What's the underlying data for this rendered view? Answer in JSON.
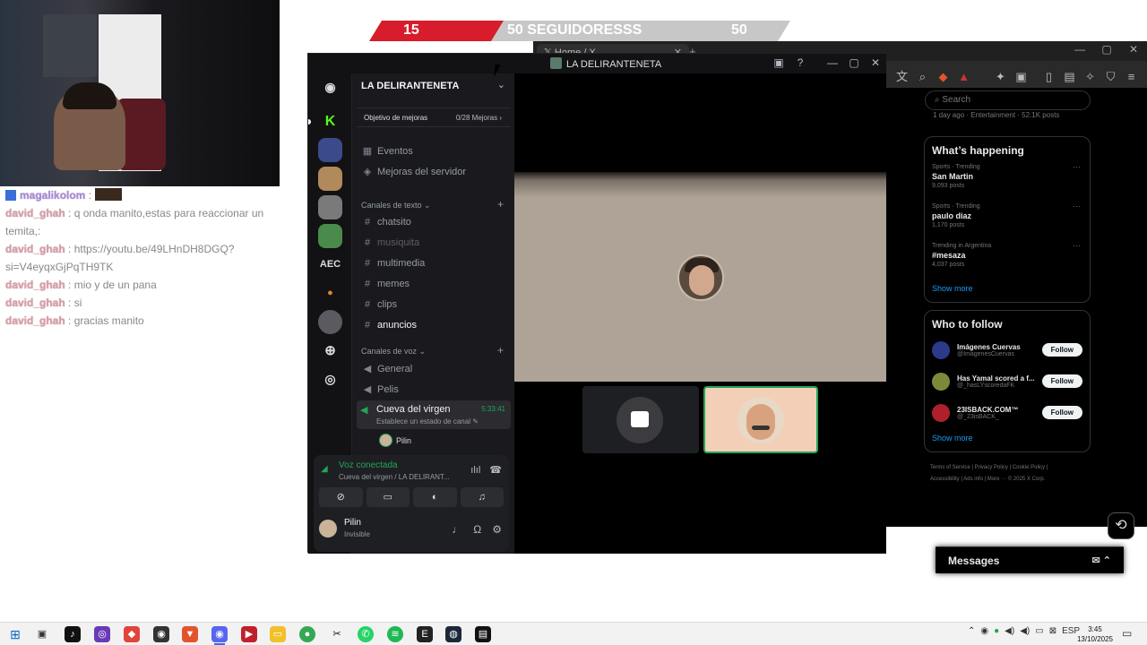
{
  "follower_goal": {
    "current": "15",
    "label": "50 SEGUIDORESSS",
    "goal": "50",
    "progress_fraction": 0.3
  },
  "chat": {
    "messages": [
      {
        "user": "magalikolom",
        "text": ":",
        "badge": "twitch-badge"
      },
      {
        "user": "david_ghah",
        "text": ": q onda manito,estas para reaccionar un temita,:"
      },
      {
        "user": "david_ghah",
        "text": ": https://youtu.be/49LHnDH8DGQ?si=V4eyqxGjPqTH9TK"
      },
      {
        "user": "david_ghah",
        "text": ": mio y de un pana"
      },
      {
        "user": "david_ghah",
        "text": ": si"
      },
      {
        "user": "david_ghah",
        "text": ": gracias manito"
      }
    ]
  },
  "browser": {
    "tab_title": "Home / X",
    "search_placeholder": "Search",
    "top_meta": "1 day ago · Entertainment · 52.1K posts",
    "happening": {
      "title": "What’s happening",
      "trends": [
        {
          "meta": "Sports · Trending",
          "name": "San Martin",
          "posts": "9,093 posts"
        },
        {
          "meta": "Sports · Trending",
          "name": "paulo diaz",
          "posts": "1,170 posts"
        },
        {
          "meta": "Trending in Argentina",
          "name": "#mesaza",
          "posts": "4,037 posts"
        }
      ],
      "show_more": "Show more"
    },
    "who_to_follow": {
      "title": "Who to follow",
      "accounts": [
        {
          "name": "Imágenes Cuervas",
          "handle": "@ImagenesCuervas",
          "button": "Follow"
        },
        {
          "name": "Has Yamal scored a f...",
          "handle": "@_hasLYscoredaFK",
          "button": "Follow"
        },
        {
          "name": "23ISBACK.COM™",
          "handle": "@_23isBACK_",
          "button": "Follow"
        }
      ],
      "show_more": "Show more"
    },
    "legal_line1": "Terms of Service   |   Privacy Policy   |   Cookie Policy   |",
    "legal_line2": "Accessibility   |   Ads info   |   More ···   © 2025 X Corp.",
    "messages": "Messages"
  },
  "discord": {
    "window_title": "LA DELIRANTENETA",
    "server_name": "LA DELIRANTENETA",
    "boost_label": "Objetivo de mejoras",
    "boost_value": "0/28 Mejoras ›",
    "events": "Eventos",
    "boosts": "Mejoras del servidor",
    "text_category": "Canales de texto ⌄",
    "text_channels": [
      "chatsito",
      "musiquita",
      "multimedia",
      "memes",
      "clips",
      "anuncios"
    ],
    "voice_category": "Canales de voz ⌄",
    "voice_channels": [
      "General",
      "Pelis"
    ],
    "active_voice": {
      "name": "Cueva del virgen",
      "time": "5:33:41",
      "status": "Establece un estado de canal ✎"
    },
    "voice_user": "Pilin",
    "guild_text": "AEC",
    "voice_connected": "Voz conectada",
    "voice_location": "Cueva del virgen / LA DELIRANT...",
    "user_name": "Pilin",
    "user_status": "Invisible"
  },
  "taskbar": {
    "time": "3:45",
    "date": "13/10/2025",
    "lang": "ESP"
  }
}
